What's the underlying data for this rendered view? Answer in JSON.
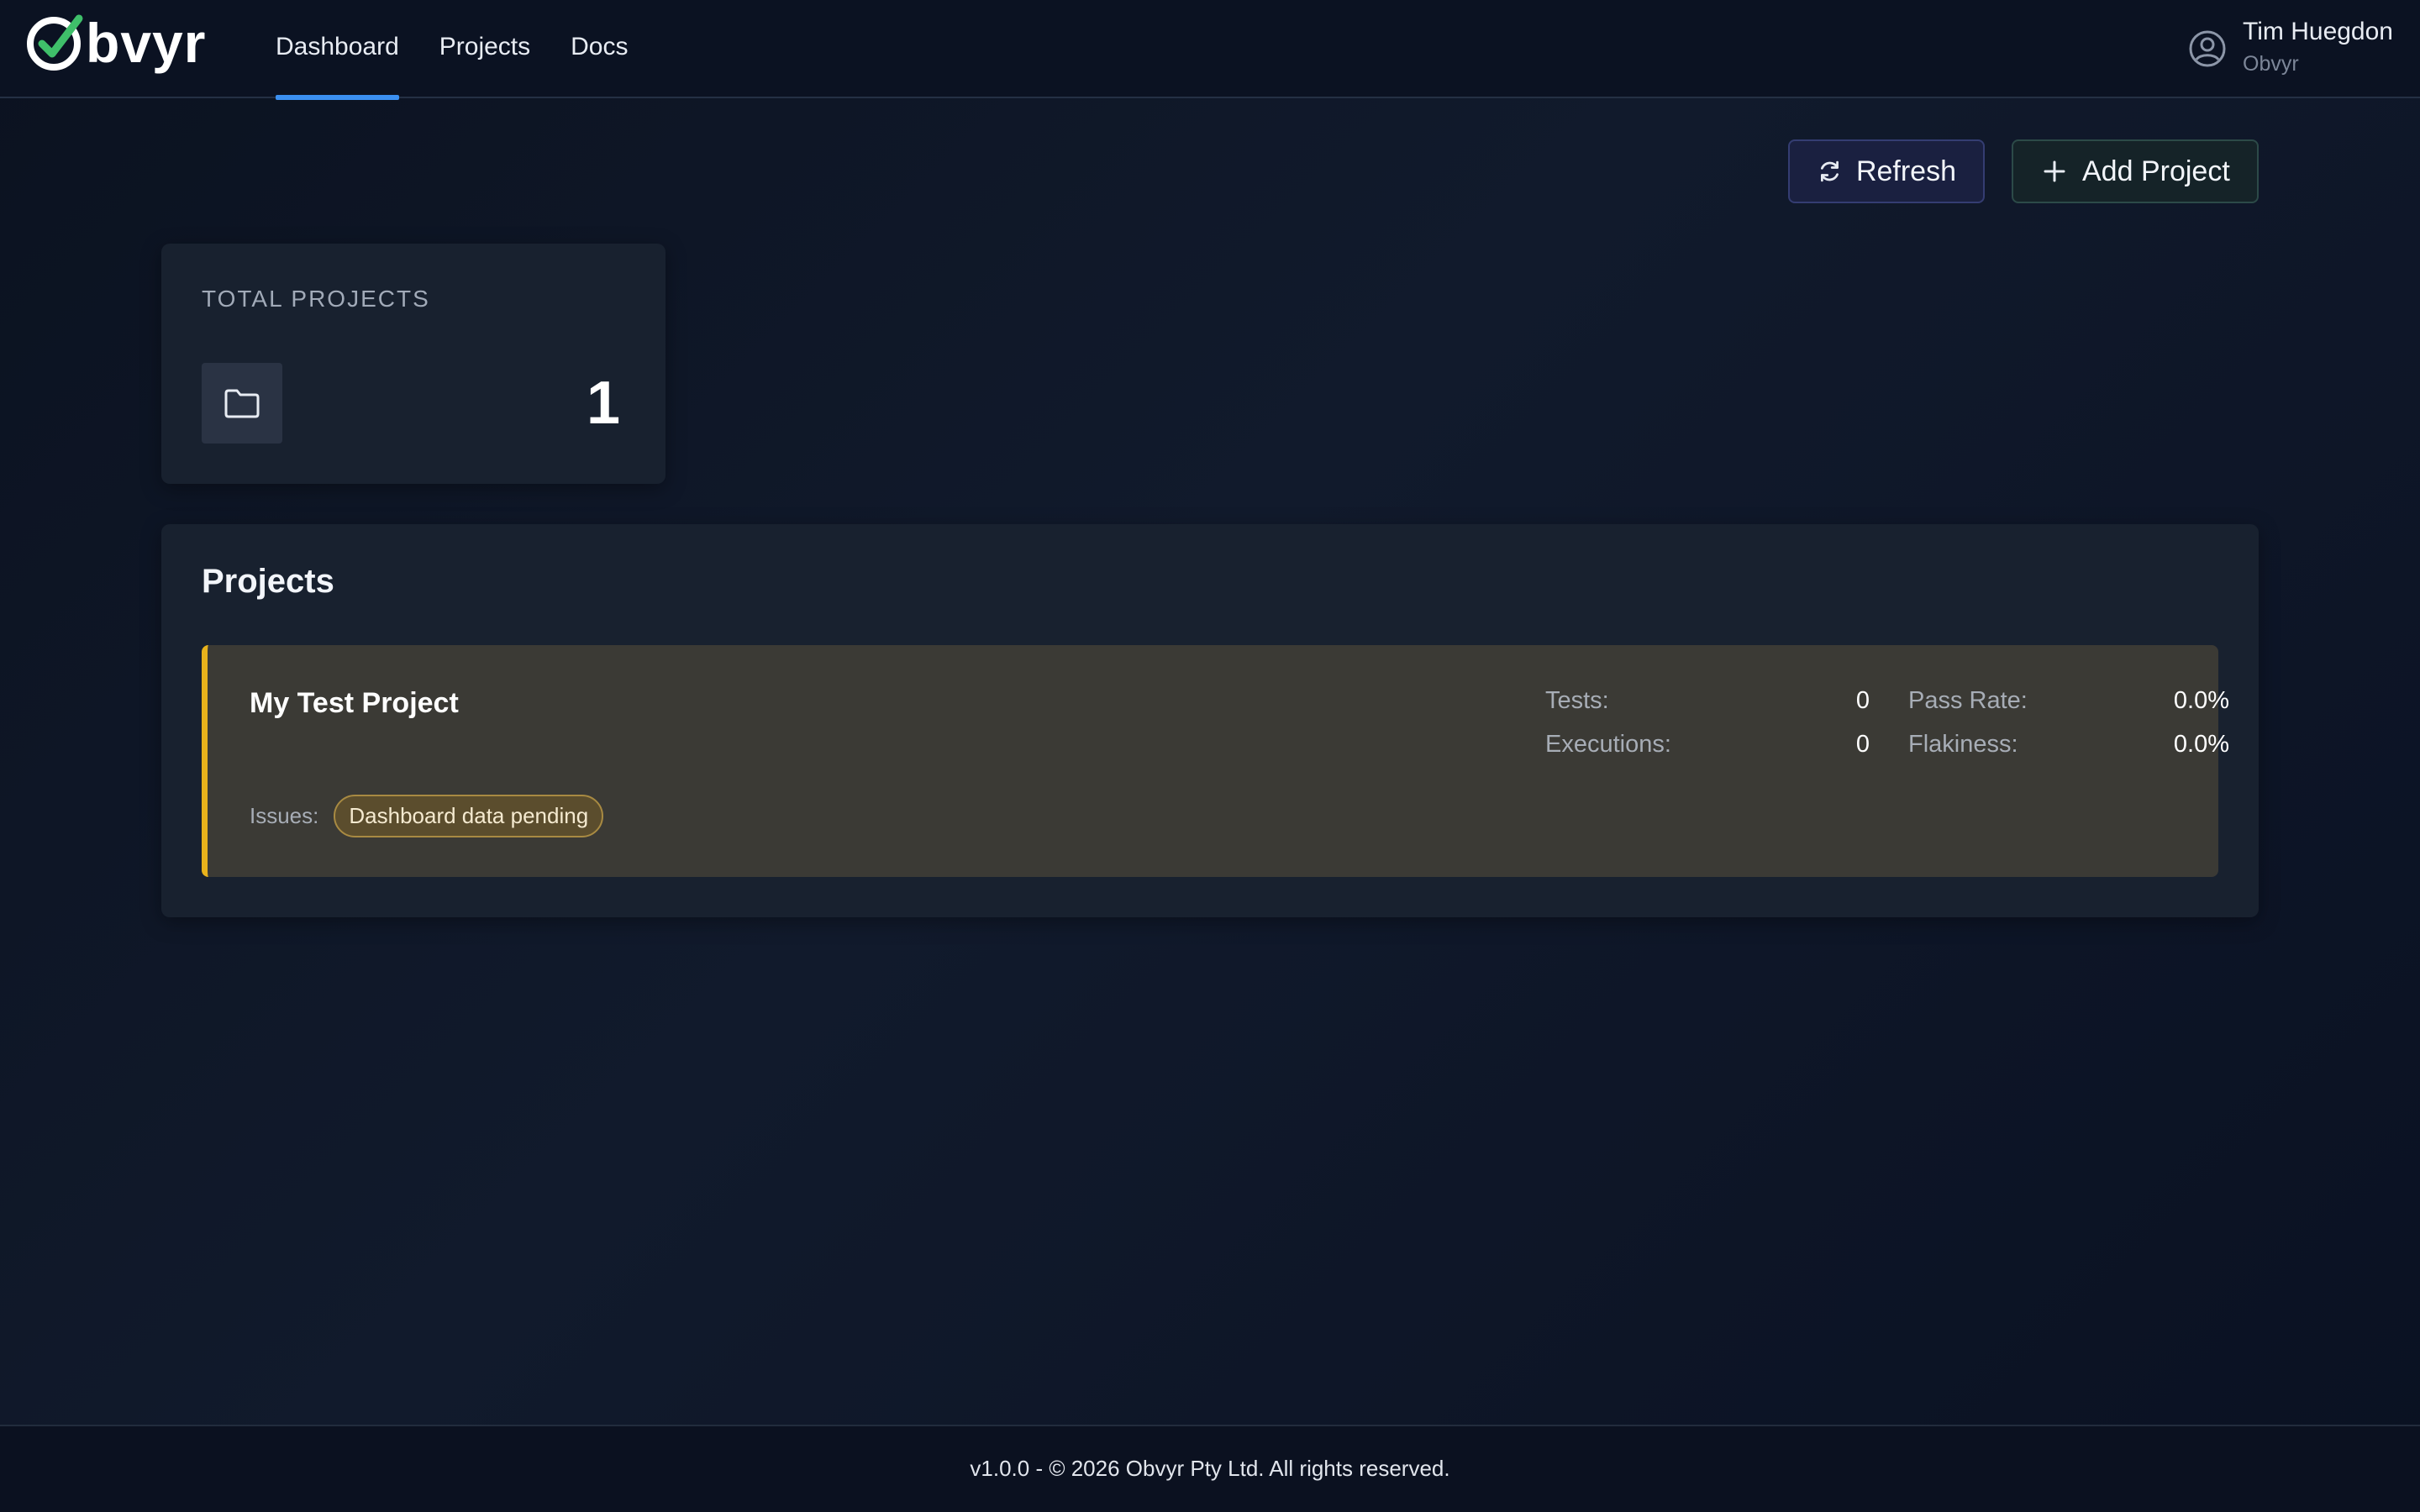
{
  "app": {
    "logo_text": "bvyr"
  },
  "nav": {
    "items": [
      {
        "label": "Dashboard",
        "active": true
      },
      {
        "label": "Projects",
        "active": false
      },
      {
        "label": "Docs",
        "active": false
      }
    ]
  },
  "user": {
    "name": "Tim Huegdon",
    "org": "Obvyr",
    "icon": "user-circle-icon"
  },
  "toolbar": {
    "refresh_label": "Refresh",
    "refresh_icon": "refresh-icon",
    "add_label": "Add Project",
    "add_icon": "plus-icon"
  },
  "stats": {
    "total_projects_label": "TOTAL PROJECTS",
    "total_projects_value": "1",
    "icon": "folder-icon"
  },
  "projects": {
    "title": "Projects",
    "items": [
      {
        "name": "My Test Project",
        "tests_label": "Tests:",
        "tests_value": "0",
        "executions_label": "Executions:",
        "executions_value": "0",
        "pass_rate_label": "Pass Rate:",
        "pass_rate_value": "0.0%",
        "flakiness_label": "Flakiness:",
        "flakiness_value": "0.0%",
        "issues_label": "Issues:",
        "issue_badge": "Dashboard data pending",
        "status_color": "#e8b21b"
      }
    ]
  },
  "footer": {
    "text": "v1.0.0 - © 2026 Obvyr Pty Ltd. All rights reserved."
  },
  "colors": {
    "accent": "#3b8ff0",
    "logo_check": "#3fbf6a",
    "warning": "#e8b21b"
  }
}
